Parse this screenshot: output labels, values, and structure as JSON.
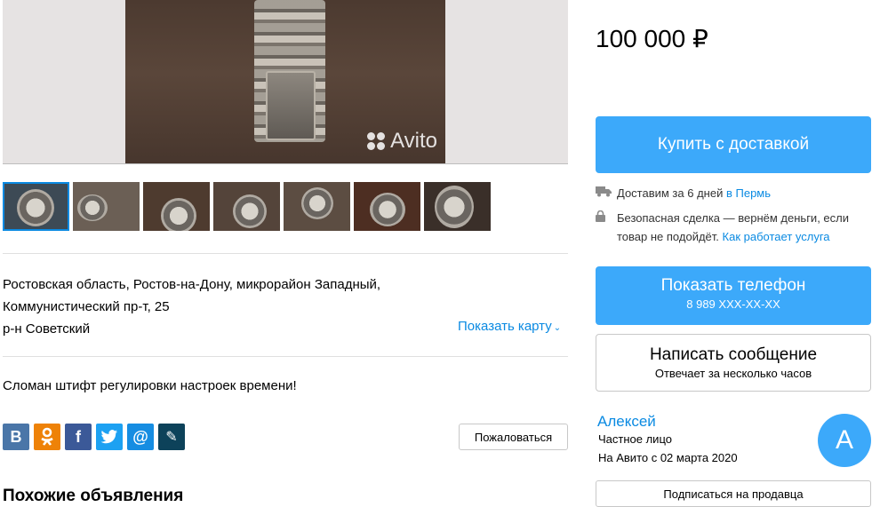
{
  "gallery": {
    "watermark": "Avito",
    "thumbnail_count": 7
  },
  "address": {
    "line1": "Ростовская область, Ростов-на-Дону, микрорайон Западный,",
    "line2": "Коммунистический пр-т, 25",
    "district": "р-н Советский",
    "show_map_label": "Показать карту"
  },
  "description": "Сломан штифт регулировки настроек времени!",
  "socials": [
    {
      "name": "vk",
      "glyph": "В",
      "color": "#4a76a8"
    },
    {
      "name": "odnoklassniki",
      "glyph": "ок",
      "color": "#ee8208"
    },
    {
      "name": "facebook",
      "glyph": "f",
      "color": "#3b5998"
    },
    {
      "name": "twitter",
      "glyph": "t",
      "color": "#1da1f2"
    },
    {
      "name": "mail",
      "glyph": "@",
      "color": "#168de2"
    },
    {
      "name": "livejournal",
      "glyph": "✎",
      "color": "#0d425a"
    }
  ],
  "complain_label": "Пожаловаться",
  "similar_heading": "Похожие объявления",
  "price": "100 000 ₽",
  "buy_button": "Купить с доставкой",
  "delivery": {
    "text": "Доставим за 6 дней",
    "prep": "в",
    "city": "Пермь"
  },
  "safe_deal": {
    "text": "Безопасная сделка — вернём деньги, если товар не подойдёт.",
    "link": "Как работает услуга"
  },
  "phone_button": {
    "label": "Показать телефон",
    "number": "8 989 XXX-XX-XX"
  },
  "message_button": {
    "label": "Написать сообщение",
    "sublabel": "Отвечает за несколько часов"
  },
  "seller": {
    "name": "Алексей",
    "type": "Частное лицо",
    "since": "На Авито с 02 марта 2020",
    "avatar_letter": "А",
    "subscribe_label": "Подписаться на продавца"
  },
  "colors": {
    "accent": "#3ca9fa",
    "link": "#0a8ae2"
  }
}
